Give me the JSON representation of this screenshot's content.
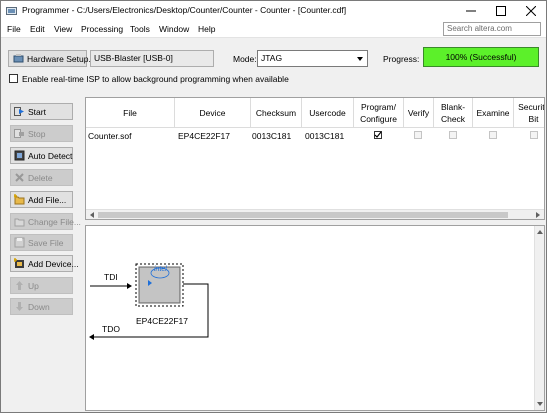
{
  "window": {
    "title": "Programmer - C:/Users/Electronics/Desktop/Counter/Counter - Counter - [Counter.cdf]"
  },
  "menu": [
    "File",
    "Edit",
    "View",
    "Processing",
    "Tools",
    "Window",
    "Help"
  ],
  "search": {
    "placeholder": "Search altera.com"
  },
  "toolbar": {
    "hardware_setup_label": "Hardware Setup...",
    "hardware_value": "USB-Blaster [USB-0]",
    "mode_label": "Mode:",
    "mode_value": "JTAG",
    "progress_label": "Progress:",
    "progress_text": "100% (Successful)",
    "progress_value": 1.0,
    "progress_color": "#5cf02a",
    "isp_label": "Enable real-time ISP to allow background programming when available",
    "isp_checked": false
  },
  "sidebar": {
    "buttons": [
      {
        "label": "Start",
        "icon": "start-icon",
        "enabled": true
      },
      {
        "label": "Stop",
        "icon": "stop-icon",
        "enabled": false
      },
      {
        "label": "Auto Detect",
        "icon": "auto-detect-icon",
        "enabled": true
      },
      {
        "label": "Delete",
        "icon": "delete-icon",
        "enabled": false
      },
      {
        "label": "Add File...",
        "icon": "add-file-icon",
        "enabled": true
      },
      {
        "label": "Change File...",
        "icon": "change-file-icon",
        "enabled": false
      },
      {
        "label": "Save File",
        "icon": "save-file-icon",
        "enabled": false
      },
      {
        "label": "Add Device...",
        "icon": "add-device-icon",
        "enabled": true
      },
      {
        "label": "Up",
        "icon": "up-icon",
        "enabled": false
      },
      {
        "label": "Down",
        "icon": "down-icon",
        "enabled": false
      }
    ]
  },
  "table": {
    "headers": [
      "File",
      "Device",
      "Checksum",
      "Usercode",
      "Program/\nConfigure",
      "Verify",
      "Blank-\nCheck",
      "Examine",
      "Security\nBit"
    ],
    "rows": [
      {
        "file": "Counter.sof",
        "device": "EP4CE22F17",
        "checksum": "0013C181",
        "usercode": "0013C181",
        "program": true,
        "verify": false,
        "blank_check": false,
        "examine": false,
        "security_bit": false
      }
    ]
  },
  "diagram": {
    "tdi_label": "TDI",
    "tdo_label": "TDO",
    "device_name": "EP4CE22F17",
    "chip_logo": "intel"
  }
}
